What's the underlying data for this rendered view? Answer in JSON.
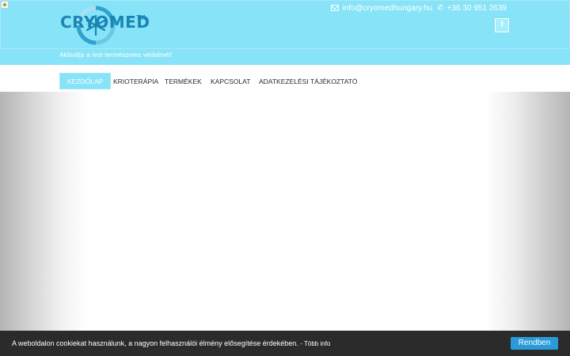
{
  "header": {
    "logo_text": "CRYOMED",
    "logo_tm": "TM",
    "email": "info@cryomedhungary.hu",
    "phone": "+36 30 951 2639",
    "facebook_label": "f",
    "tagline": "Aktiválja a test természetes védelmét!"
  },
  "nav": {
    "items": [
      {
        "label": "KEZDŐLAP",
        "active": true
      },
      {
        "label": "KRIOTERÁPIA",
        "active": false
      },
      {
        "label": "TERMÉKEK",
        "active": false
      },
      {
        "label": "KAPCSOLAT",
        "active": false
      },
      {
        "label": "ADATKEZELÉSI TÁJÉKOZTATÓ",
        "active": false
      }
    ]
  },
  "cookie": {
    "text": "A weboldalon cookiekat használunk, a nagyon felhasználói élmény elősegítése érdekében.",
    "more_link": "- Több info",
    "button": "Rendben"
  },
  "colors": {
    "header_bg": "#87e3f7",
    "logo_blue": "#1a86b4",
    "cookie_bg": "#2b2b2b",
    "button_blue": "#2a9bd8"
  },
  "icons": [
    "broken-image-icon",
    "envelope-icon",
    "phone-icon",
    "facebook-icon",
    "logo-snowflake-icon"
  ]
}
